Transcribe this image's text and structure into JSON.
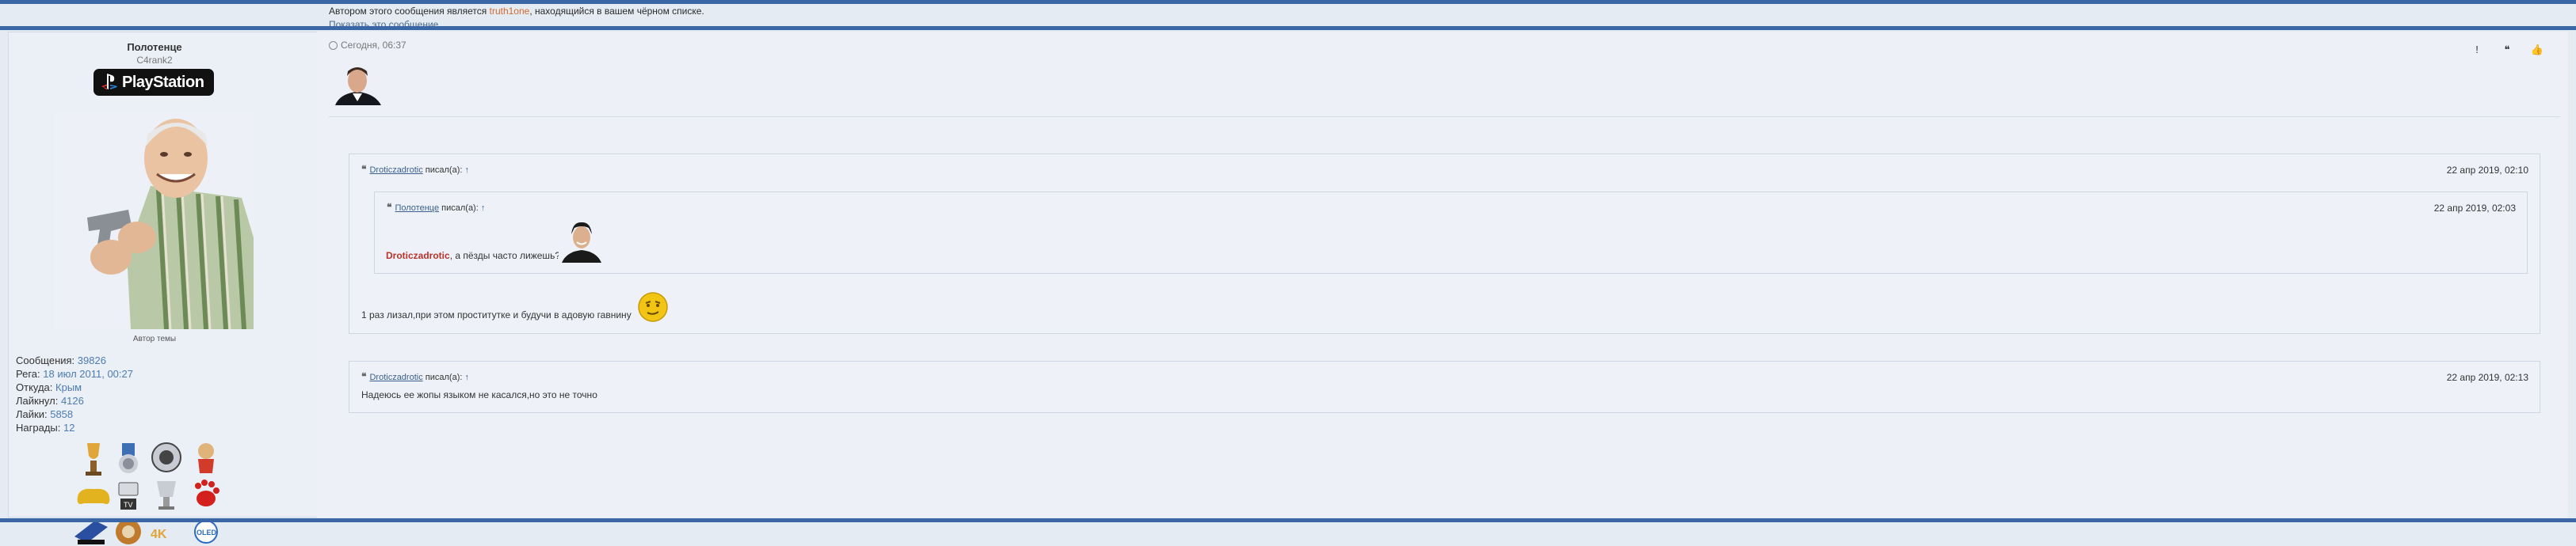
{
  "blocked_notice": {
    "prefix": "Автором этого сообщения является",
    "username": "truth1one",
    "suffix": ", находящийся в вашем чёрном списке.",
    "show_link": "Показать это сообщение."
  },
  "user": {
    "name": "Полотенце",
    "title": "C4rank2",
    "badge": "PlayStation",
    "author_label": "Автор темы",
    "stats": [
      {
        "label": "Сообщения:",
        "value": "39826"
      },
      {
        "label": "Рега:",
        "value": "18 июл 2011, 00:27"
      },
      {
        "label": "Откуда:",
        "value": "Крым"
      },
      {
        "label": "Лайкнул:",
        "value": "4126"
      },
      {
        "label": "Лайки:",
        "value": "5858"
      },
      {
        "label": "Награды:",
        "value": "12"
      }
    ],
    "award_text": "4K"
  },
  "post": {
    "time": "Сегодня, 06:37",
    "actions": {
      "report": "!",
      "quote": "❝",
      "like": "👍"
    }
  },
  "quotes": {
    "outer": {
      "author": "Droticzadrotic",
      "wrote": "писал(а):",
      "arrow": "↑",
      "date": "22 апр 2019, 02:10",
      "text": "1 раз лизал,при этом проститутке и будучи в адовую гавнину"
    },
    "inner": {
      "author": "Полотенце",
      "wrote": "писал(а):",
      "arrow": "↑",
      "date": "22 апр 2019, 02:03",
      "mention": "Droticzadrotic",
      "text": ", а пёзды часто лижешь?"
    },
    "second": {
      "author": "Droticzadrotic",
      "wrote": "писал(а):",
      "arrow": "↑",
      "date": "22 апр 2019, 02:13",
      "text": "Надеюсь ее жопы языком не касался,но это не точно"
    }
  },
  "colors": {
    "accent_bar": "#3b67a6",
    "page_bg": "#e4ebf3",
    "blocked_username": "#d26b2f",
    "mention": "#b8322a",
    "stat_value": "#4d7cb0"
  }
}
